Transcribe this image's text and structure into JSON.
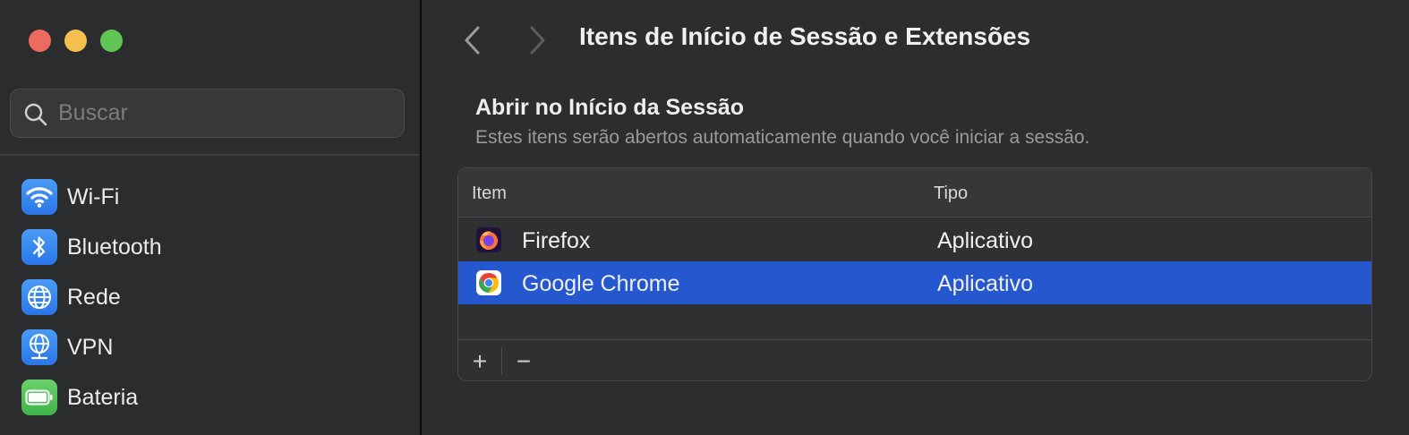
{
  "search": {
    "placeholder": "Buscar"
  },
  "sidebar": {
    "items": [
      {
        "label": "Wi-Fi",
        "icon": "wifi-icon",
        "color": "#2f7df0"
      },
      {
        "label": "Bluetooth",
        "icon": "bluetooth-icon",
        "color": "#2f7df0"
      },
      {
        "label": "Rede",
        "icon": "globe-icon",
        "color": "#2f7df0"
      },
      {
        "label": "VPN",
        "icon": "vpn-globe-icon",
        "color": "#2f7df0"
      },
      {
        "label": "Bateria",
        "icon": "battery-icon",
        "color": "#4fc15a"
      }
    ]
  },
  "header": {
    "title": "Itens de Início de Sessão e Extensões"
  },
  "section": {
    "title": "Abrir no Início da Sessão",
    "subtitle": "Estes itens serão abertos automaticamente quando você iniciar a sessão."
  },
  "table": {
    "columns": [
      "Item",
      "Tipo"
    ],
    "rows": [
      {
        "item": "Firefox",
        "type": "Aplicativo",
        "icon": "firefox-icon",
        "selected": false
      },
      {
        "item": "Google Chrome",
        "type": "Aplicativo",
        "icon": "chrome-icon",
        "selected": true
      }
    ],
    "add_label": "+",
    "remove_label": "−"
  },
  "colors": {
    "selection": "#2557cf",
    "accent": "#2f7df0"
  }
}
